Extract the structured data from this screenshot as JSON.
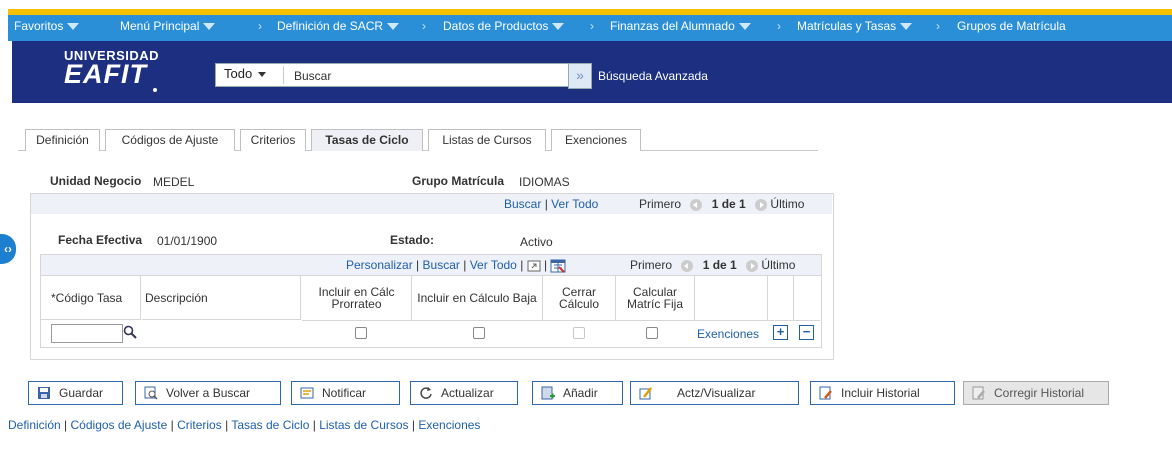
{
  "topnav": {
    "items": [
      "Favoritos",
      "Menú Principal",
      "Definición de SACR",
      "Datos de Productos",
      "Finanzas del Alumnado",
      "Matrículas y Tasas",
      "Grupos de Matrícula"
    ]
  },
  "header": {
    "logo_line1": "UNIVERSIDAD",
    "logo_line2": "EAFIT",
    "search_scope": "Todo",
    "search_placeholder": "Buscar",
    "search_go": "»",
    "advanced_search": "Búsqueda Avanzada"
  },
  "tabs": [
    {
      "label": "Definición",
      "active": false
    },
    {
      "label": "Códigos de Ajuste",
      "active": false
    },
    {
      "label": "Criterios",
      "active": false
    },
    {
      "label": "Tasas de Ciclo",
      "active": true
    },
    {
      "label": "Listas de Cursos",
      "active": false
    },
    {
      "label": "Exenciones",
      "active": false
    }
  ],
  "fields": {
    "unidad_label": "Unidad Negocio",
    "unidad_value": "MEDEL",
    "grupo_label": "Grupo Matrícula",
    "grupo_value": "IDIOMAS"
  },
  "outer_nav": {
    "buscar": "Buscar",
    "ver_todo": "Ver Todo",
    "primero": "Primero",
    "count": "1 de 1",
    "ultimo": "Último"
  },
  "effective": {
    "fecha_label": "Fecha Efectiva",
    "fecha_value": "01/01/1900",
    "estado_label": "Estado:",
    "estado_value": "Activo"
  },
  "grid": {
    "personalizar": "Personalizar",
    "buscar": "Buscar",
    "ver_todo": "Ver Todo",
    "primero": "Primero",
    "count": "1 de 1",
    "ultimo": "Último",
    "columns": [
      "*Código Tasa",
      "Descripción",
      "Incluir en Cálc Prorrateo",
      "Incluir en Cálculo Baja",
      "Cerrar Cálculo",
      "Calcular Matríc Fija"
    ],
    "row": {
      "codigo": "",
      "exenciones_link": "Exenciones",
      "add": "+",
      "remove": "−"
    }
  },
  "buttons": {
    "guardar": "Guardar",
    "volver": "Volver a Buscar",
    "notificar": "Notificar",
    "actualizar": "Actualizar",
    "anadir": "Añadir",
    "actz": "Actz/Visualizar",
    "incluir_historial": "Incluir Historial",
    "corregir_historial": "Corregir Historial"
  },
  "footer_links": [
    "Definición",
    "Códigos de Ajuste",
    "Criterios",
    "Tasas de Ciclo",
    "Listas de Cursos",
    "Exenciones"
  ],
  "colors": {
    "nav_bar": "#2a8fd6",
    "header_band": "#1c2f80",
    "link": "#1f5fa8",
    "button_border": "#2d67b0"
  }
}
